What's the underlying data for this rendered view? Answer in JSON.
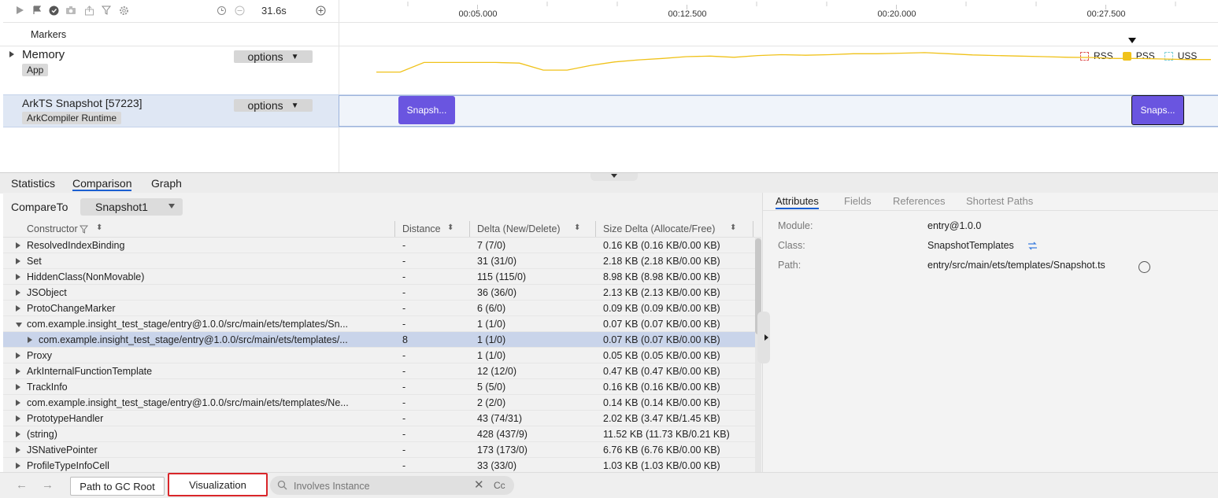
{
  "toolbar": {
    "duration": "31.6s",
    "icons": [
      "play-icon",
      "flag-icon",
      "gc-icon",
      "camera-icon",
      "export-icon",
      "filter-icon",
      "settings-icon",
      "reset-icon",
      "minus-icon",
      "plus-icon"
    ]
  },
  "ruler": {
    "ticks": [
      "00:05.000",
      "00:12.500",
      "00:20.000",
      "00:27.500"
    ]
  },
  "markers_label": "Markers",
  "memory": {
    "title": "Memory",
    "tag": "App",
    "options_label": "options",
    "legend": [
      {
        "label": "RSS",
        "color": "#e05a5a",
        "filled": false
      },
      {
        "label": "PSS",
        "color": "#f0c21a",
        "filled": true
      },
      {
        "label": "USS",
        "color": "#7fd0d8",
        "filled": false
      }
    ],
    "series_values": [
      0.55,
      0.55,
      0.88,
      0.88,
      0.88,
      0.88,
      0.86,
      0.62,
      0.62,
      0.78,
      0.9,
      0.97,
      1.02,
      1.08,
      1.1,
      1.06,
      1.12,
      1.15,
      1.13,
      1.15,
      1.18,
      1.18,
      1.2,
      1.22,
      1.18,
      1.14,
      1.12,
      1.1,
      1.08,
      1.06,
      1.05,
      1.02,
      1.02,
      1.0,
      0.98,
      0.98
    ]
  },
  "ark": {
    "title": "ArkTS Snapshot [57223]",
    "tag": "ArkCompiler Runtime",
    "options_label": "options",
    "snapshot1": "Snapsh...",
    "snapshot2": "Snaps..."
  },
  "tabs": [
    "Statistics",
    "Comparison",
    "Graph"
  ],
  "compare": {
    "label": "CompareTo",
    "selected": "Snapshot1"
  },
  "columns": {
    "constructor": "Constructor",
    "distance": "Distance",
    "delta": "Delta (New/Delete)",
    "size_delta": "Size Delta (Allocate/Free)"
  },
  "rows": [
    {
      "name": "ResolvedIndexBinding",
      "distance": "-",
      "delta": "7 (7/0)",
      "size": "0.16 KB (0.16 KB/0.00 KB)",
      "expand": "r",
      "indent": 0
    },
    {
      "name": "Set",
      "distance": "-",
      "delta": "31 (31/0)",
      "size": "2.18 KB (2.18 KB/0.00 KB)",
      "expand": "r",
      "indent": 0
    },
    {
      "name": "HiddenClass(NonMovable)",
      "distance": "-",
      "delta": "115 (115/0)",
      "size": "8.98 KB (8.98 KB/0.00 KB)",
      "expand": "r",
      "indent": 0
    },
    {
      "name": "JSObject",
      "distance": "-",
      "delta": "36 (36/0)",
      "size": "2.13 KB (2.13 KB/0.00 KB)",
      "expand": "r",
      "indent": 0
    },
    {
      "name": "ProtoChangeMarker",
      "distance": "-",
      "delta": "6 (6/0)",
      "size": "0.09 KB (0.09 KB/0.00 KB)",
      "expand": "r",
      "indent": 0
    },
    {
      "name": "com.example.insight_test_stage/entry@1.0.0/src/main/ets/templates/Sn...",
      "distance": "-",
      "delta": "1 (1/0)",
      "size": "0.07 KB (0.07 KB/0.00 KB)",
      "expand": "d",
      "indent": 0
    },
    {
      "name": "com.example.insight_test_stage/entry@1.0.0/src/main/ets/templates/...",
      "distance": "8",
      "delta": "1 (1/0)",
      "size": "0.07 KB (0.07 KB/0.00 KB)",
      "expand": "r",
      "indent": 1,
      "selected": true
    },
    {
      "name": "Proxy",
      "distance": "-",
      "delta": "1 (1/0)",
      "size": "0.05 KB (0.05 KB/0.00 KB)",
      "expand": "r",
      "indent": 0
    },
    {
      "name": "ArkInternalFunctionTemplate",
      "distance": "-",
      "delta": "12 (12/0)",
      "size": "0.47 KB (0.47 KB/0.00 KB)",
      "expand": "r",
      "indent": 0
    },
    {
      "name": "TrackInfo",
      "distance": "-",
      "delta": "5 (5/0)",
      "size": "0.16 KB (0.16 KB/0.00 KB)",
      "expand": "r",
      "indent": 0
    },
    {
      "name": "com.example.insight_test_stage/entry@1.0.0/src/main/ets/templates/Ne...",
      "distance": "-",
      "delta": "2 (2/0)",
      "size": "0.14 KB (0.14 KB/0.00 KB)",
      "expand": "r",
      "indent": 0
    },
    {
      "name": "PrototypeHandler",
      "distance": "-",
      "delta": "43 (74/31)",
      "size": "2.02 KB (3.47 KB/1.45 KB)",
      "expand": "r",
      "indent": 0
    },
    {
      "name": "(string)",
      "distance": "-",
      "delta": "428 (437/9)",
      "size": "11.52 KB (11.73 KB/0.21 KB)",
      "expand": "r",
      "indent": 0
    },
    {
      "name": "JSNativePointer",
      "distance": "-",
      "delta": "173 (173/0)",
      "size": "6.76 KB (6.76 KB/0.00 KB)",
      "expand": "r",
      "indent": 0
    },
    {
      "name": "ProfileTypeInfoCell",
      "distance": "-",
      "delta": "33 (33/0)",
      "size": "1.03 KB (1.03 KB/0.00 KB)",
      "expand": "r",
      "indent": 0
    }
  ],
  "right_tabs": [
    "Attributes",
    "Fields",
    "References",
    "Shortest Paths"
  ],
  "attributes": [
    {
      "key": "Module:",
      "value": "entry@1.0.0"
    },
    {
      "key": "Class:",
      "value": "SnapshotTemplates"
    },
    {
      "key": "Path:",
      "value": "entry/src/main/ets/templates/Snapshot.ts"
    }
  ],
  "bottom": {
    "path_button": "Path to GC Root",
    "visualization_button": "Visualization",
    "search_placeholder": "Involves Instance",
    "case_label": "Cc"
  }
}
